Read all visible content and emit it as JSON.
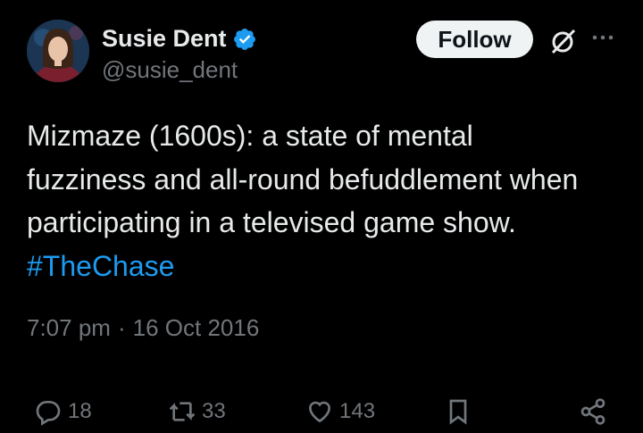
{
  "author": {
    "display_name": "Susie Dent",
    "handle": "@susie_dent",
    "verified": true,
    "avatar_icon": "avatar-photo"
  },
  "follow_button": {
    "label": "Follow"
  },
  "tweet": {
    "text_main": "Mizmaze (1600s): a state of mental fuzziness and all-round befuddlement when participating in a televised game show.",
    "hashtag": "#TheChase"
  },
  "meta": {
    "time": "7:07 pm",
    "separator": "·",
    "date": "16 Oct 2016"
  },
  "actions": {
    "replies": "18",
    "retweets": "33",
    "likes": "143"
  },
  "colors": {
    "background": "#000000",
    "text": "#e7e9ea",
    "muted": "#71767b",
    "accent": "#1d9bf0"
  }
}
